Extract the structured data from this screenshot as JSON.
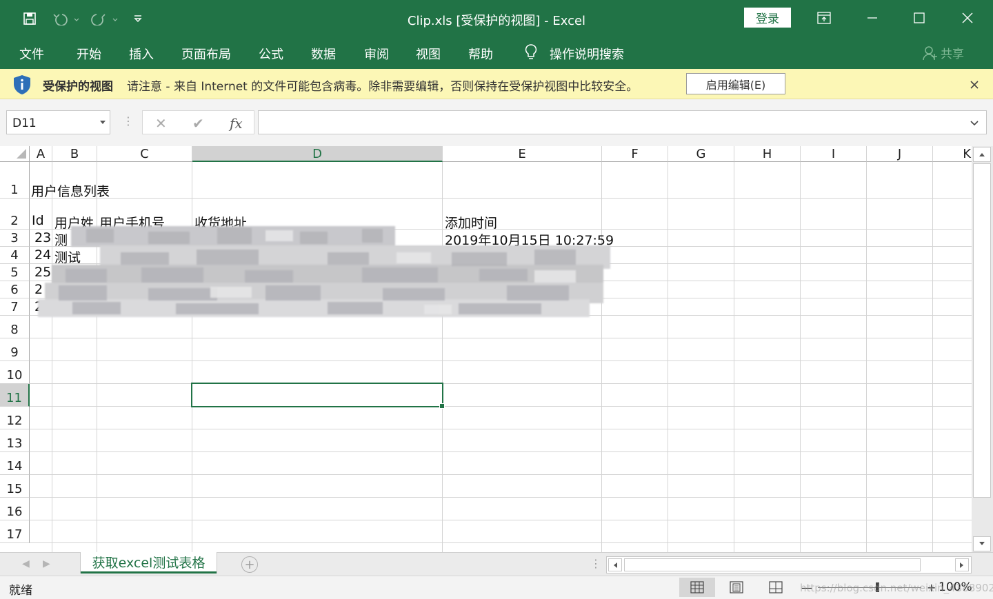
{
  "window": {
    "title": "Clip.xls  [受保护的视图]  -  Excel",
    "login_label": "登录"
  },
  "ribbon": {
    "tabs": [
      "文件",
      "开始",
      "插入",
      "页面布局",
      "公式",
      "数据",
      "审阅",
      "视图",
      "帮助"
    ],
    "tell_me": "操作说明搜索",
    "share": "共享"
  },
  "protected_view": {
    "title": "受保护的视图",
    "message": "请注意 - 来自 Internet 的文件可能包含病毒。除非需要编辑，否则保持在受保护视图中比较安全。",
    "enable_button": "启用编辑(E)"
  },
  "formula_bar": {
    "name_box": "D11",
    "cancel_symbol": "✕",
    "enter_symbol": "✔",
    "fx_label": "fx",
    "value": ""
  },
  "grid": {
    "columns": [
      "A",
      "B",
      "C",
      "D",
      "E",
      "F",
      "G",
      "H",
      "I",
      "J",
      "K"
    ],
    "selected_column": "D",
    "rows": [
      "1",
      "2",
      "3",
      "4",
      "5",
      "6",
      "7",
      "8",
      "9",
      "10",
      "11",
      "12",
      "13",
      "14",
      "15",
      "16",
      "17"
    ],
    "selected_row": "11",
    "cells": {
      "A1": "用户信息列表",
      "A2": "Id",
      "B2": "用户姓",
      "C2": "用户手机号",
      "D2": "收货地址",
      "E2": "添加时间",
      "A3": "23",
      "B3": "测",
      "E3": "2019年10月15日 10:27:59",
      "A4": "24",
      "B4": "测试",
      "A5": "25",
      "A6": "2",
      "A7": "2"
    }
  },
  "sheets": {
    "active": "获取excel测试表格"
  },
  "status": {
    "ready": "就绪",
    "zoom": "100%",
    "watermark": "https://blog.csdn.net/weixin_43889026"
  }
}
